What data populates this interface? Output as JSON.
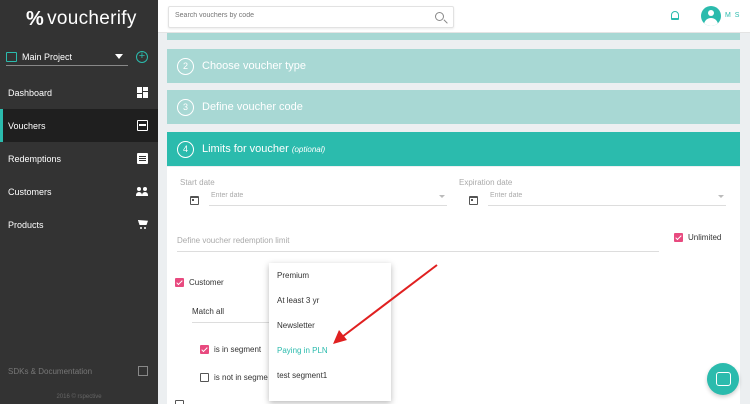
{
  "app": {
    "logo": "voucherify",
    "logo_symbol": "%"
  },
  "sidebar": {
    "project": "Main Project",
    "items": [
      {
        "label": "Dashboard",
        "icon": "dashboard-icon"
      },
      {
        "label": "Vouchers",
        "icon": "voucher-icon",
        "active": true
      },
      {
        "label": "Redemptions",
        "icon": "list-icon"
      },
      {
        "label": "Customers",
        "icon": "people-icon"
      },
      {
        "label": "Products",
        "icon": "cart-icon"
      }
    ],
    "sdk_label": "SDKs & Documentation",
    "copyright": "2016 © rspective"
  },
  "topbar": {
    "search_placeholder": "Search vouchers by code",
    "user_initials": "M S"
  },
  "steps": [
    {
      "num": "2",
      "label": "Choose voucher type"
    },
    {
      "num": "3",
      "label": "Define voucher code"
    },
    {
      "num": "4",
      "label": "Limits for voucher",
      "optional": "(optional)"
    }
  ],
  "limits": {
    "start_date_label": "Start date",
    "start_date_placeholder": "Enter date",
    "expiration_date_label": "Expiration date",
    "expiration_date_placeholder": "Enter date",
    "redemption_limit_placeholder": "Define voucher redemption limit",
    "unlimited_label": "Unlimited",
    "customer_label": "Customer",
    "match_label": "Match all",
    "is_in_segment_label": "is in segment",
    "is_not_in_segment_label": "is not in segme"
  },
  "dropdown": {
    "options": [
      "Premium",
      "At least 3 yr",
      "Newsletter",
      "Paying in PLN",
      "test segment1"
    ],
    "highlighted": "Paying in PLN"
  },
  "colors": {
    "accent": "#2bbbad",
    "accent_light": "#a8d8d4",
    "checkbox": "#e84a7f",
    "sidebar": "#333333",
    "arrow": "#e02020"
  }
}
